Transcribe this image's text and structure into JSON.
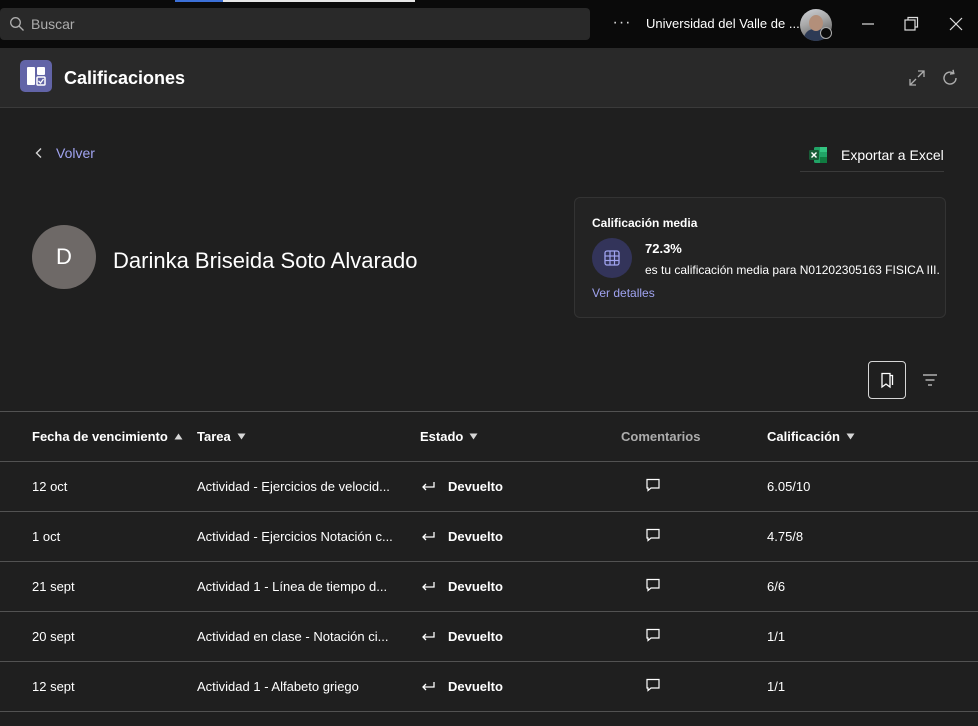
{
  "titlebar": {
    "search_placeholder": "Buscar",
    "more_label": "···",
    "organization": "Universidad del Valle de ..."
  },
  "app": {
    "title": "Calificaciones"
  },
  "nav": {
    "back_label": "Volver",
    "export_label": "Exportar a Excel"
  },
  "student": {
    "initial": "D",
    "name": "Darinka Briseida Soto Alvarado"
  },
  "average": {
    "title": "Calificación media",
    "value": "72.3%",
    "description": "es tu calificación media para N01202305163 FISICA III.",
    "link": "Ver detalles"
  },
  "table": {
    "headers": {
      "due_date": "Fecha de vencimiento",
      "task": "Tarea",
      "status": "Estado",
      "comments": "Comentarios",
      "grade": "Calificación"
    },
    "rows": [
      {
        "due": "12 oct",
        "task": "Actividad - Ejercicios de velocid...",
        "status": "Devuelto",
        "grade": "6.05/10"
      },
      {
        "due": "1 oct",
        "task": "Actividad - Ejercicios Notación c...",
        "status": "Devuelto",
        "grade": "4.75/8"
      },
      {
        "due": "21 sept",
        "task": "Actividad 1 - Línea de tiempo d...",
        "status": "Devuelto",
        "grade": "6/6"
      },
      {
        "due": "20 sept",
        "task": "Actividad en clase - Notación ci...",
        "status": "Devuelto",
        "grade": "1/1"
      },
      {
        "due": "12 sept",
        "task": "Actividad 1 - Alfabeto griego",
        "status": "Devuelto",
        "grade": "1/1"
      }
    ]
  },
  "colors": {
    "accent": "#6264a7",
    "link": "#a0a3f0",
    "background": "#1f1f1f",
    "header": "#292929",
    "titlebar": "#0a0a0a"
  }
}
